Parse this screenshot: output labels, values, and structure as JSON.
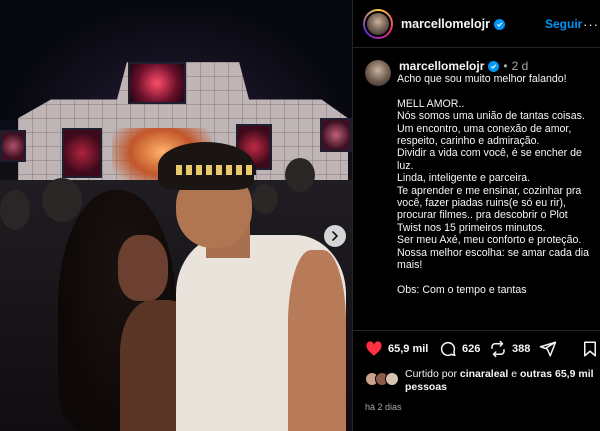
{
  "post": {
    "carousel_next_icon": "chevron-right-icon"
  },
  "header": {
    "username": "marcellomelojr",
    "verified_icon": "verified-badge-icon",
    "follow_label": "Seguir",
    "more_label": "···"
  },
  "caption": {
    "username": "marcellomelojr",
    "dot": "•",
    "time": "2 d",
    "lines": [
      "Acho que sou muito melhor falando!",
      "",
      "MELL AMOR..",
      "Nós somos uma união de tantas coisas.",
      "Um encontro, uma conexão de amor,",
      "respeito, carinho e admiração.",
      "Dividir a vida com você, é se encher de",
      "luz.",
      "Linda, inteligente e parceira.",
      "Te aprender e me ensinar, cozinhar pra",
      "você, fazer piadas ruins(e só eu rir),",
      "procurar filmes.. pra descobrir o Plot",
      "Twist nos 15 primeiros minutos.",
      "Ser meu Axé, meu conforto e proteção.",
      "Nossa melhor escolha: se amar cada dia",
      "mais!",
      "",
      "Obs: Com o tempo e tantas"
    ]
  },
  "actions": {
    "likes": "65,9 mil",
    "comments": "626",
    "reposts": "388",
    "icons": [
      "heart-filled-icon",
      "comment-icon",
      "repost-icon",
      "share-icon",
      "bookmark-icon"
    ],
    "like_color": "#ff3040"
  },
  "liked_by": {
    "prefix": "Curtido por ",
    "user": "cinaraleal",
    "middle": " e ",
    "others": "outras 65,9 mil",
    "suffix": "pessoas"
  },
  "footer": {
    "ago": "há 2 dias"
  },
  "colors": {
    "background": "#000000",
    "accent": "#0095f6",
    "muted": "#a8a8a8",
    "divider": "#262626"
  }
}
